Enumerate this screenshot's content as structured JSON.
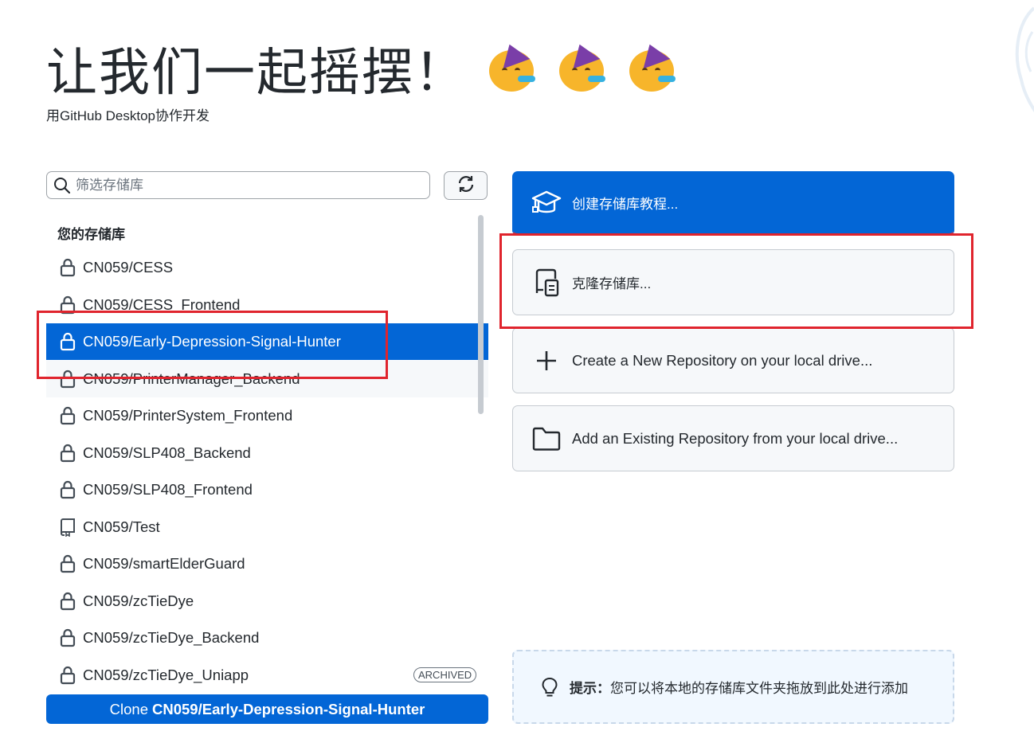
{
  "header": {
    "title": "让我们一起摇摆！",
    "subtitle": "用GitHub Desktop协作开发",
    "emojis": [
      "party-face-icon",
      "party-face-icon",
      "party-face-icon"
    ]
  },
  "search": {
    "placeholder": "筛选存储库",
    "value": ""
  },
  "repo_list": {
    "section_title": "您的存储库",
    "items": [
      {
        "name": "CN059/CESS",
        "icon": "lock-icon"
      },
      {
        "name": "CN059/CESS_Frontend",
        "icon": "lock-icon"
      },
      {
        "name": "CN059/Early-Depression-Signal-Hunter",
        "icon": "lock-icon",
        "selected": true
      },
      {
        "name": "CN059/PrinterManager_Backend",
        "icon": "lock-icon"
      },
      {
        "name": "CN059/PrinterSystem_Frontend",
        "icon": "lock-icon"
      },
      {
        "name": "CN059/SLP408_Backend",
        "icon": "lock-icon"
      },
      {
        "name": "CN059/SLP408_Frontend",
        "icon": "lock-icon"
      },
      {
        "name": "CN059/Test",
        "icon": "repo-icon"
      },
      {
        "name": "CN059/smartElderGuard",
        "icon": "lock-icon"
      },
      {
        "name": "CN059/zcTieDye",
        "icon": "lock-icon"
      },
      {
        "name": "CN059/zcTieDye_Backend",
        "icon": "lock-icon"
      },
      {
        "name": "CN059/zcTieDye_Uniapp",
        "icon": "lock-icon",
        "badge": "ARCHIVED"
      }
    ]
  },
  "clone_button": {
    "prefix": "Clone",
    "repo": "CN059/Early-Depression-Signal-Hunter"
  },
  "actions": [
    {
      "label": "创建存储库教程...",
      "icon": "graduation-cap-icon"
    },
    {
      "label": "克隆存储库...",
      "icon": "desktop-download-icon"
    },
    {
      "label": "Create a New Repository on your local drive...",
      "icon": "plus-icon"
    },
    {
      "label": "Add an Existing Repository from your local drive...",
      "icon": "folder-icon"
    }
  ],
  "tip": {
    "label": "提示：",
    "text": "您可以将本地的存储库文件夹拖放到此处进行添加",
    "icon": "lightbulb-icon"
  },
  "colors": {
    "accent": "#0366d6",
    "highlight_box": "#e0242d"
  }
}
